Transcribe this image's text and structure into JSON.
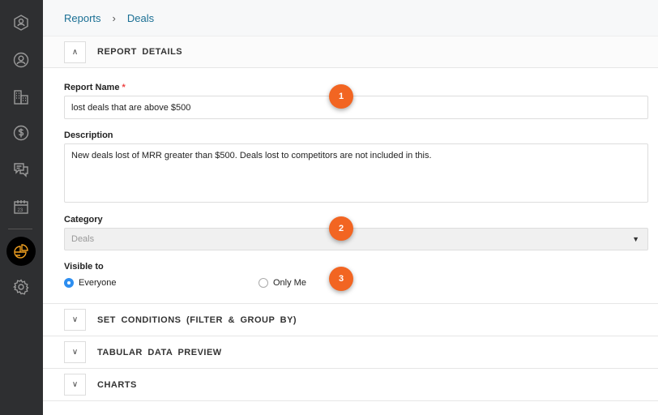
{
  "sidebar": {
    "items": [
      "contacts-hex-icon",
      "user-icon",
      "building-icon",
      "dollar-icon",
      "chat-icon",
      "calendar-icon",
      "reports-pie-icon",
      "gear-icon"
    ],
    "active": "reports-pie-icon",
    "active_color": "#f0a020"
  },
  "breadcrumb": {
    "items": [
      "Reports",
      "Deals"
    ]
  },
  "sections": {
    "report_details": "REPORT  DETAILS",
    "conditions": "SET  CONDITIONS  (FILTER  &  GROUP  BY)",
    "preview": "TABULAR  DATA  PREVIEW",
    "charts": "CHARTS"
  },
  "form": {
    "report_name_label": "Report Name",
    "required_mark": "*",
    "report_name_value": "lost deals that are above $500",
    "description_label": "Description",
    "description_value": "New deals lost of MRR greater than $500. Deals lost to competitors are not included in this.",
    "category_label": "Category",
    "category_value": "Deals",
    "visible_label": "Visible to",
    "options": [
      "Everyone",
      "Only Me"
    ],
    "selected": "Everyone"
  },
  "badges": [
    "1",
    "2",
    "3"
  ],
  "colors": {
    "badge": "#f26522",
    "link": "#1a6f94",
    "radio": "#2d8ef0"
  }
}
